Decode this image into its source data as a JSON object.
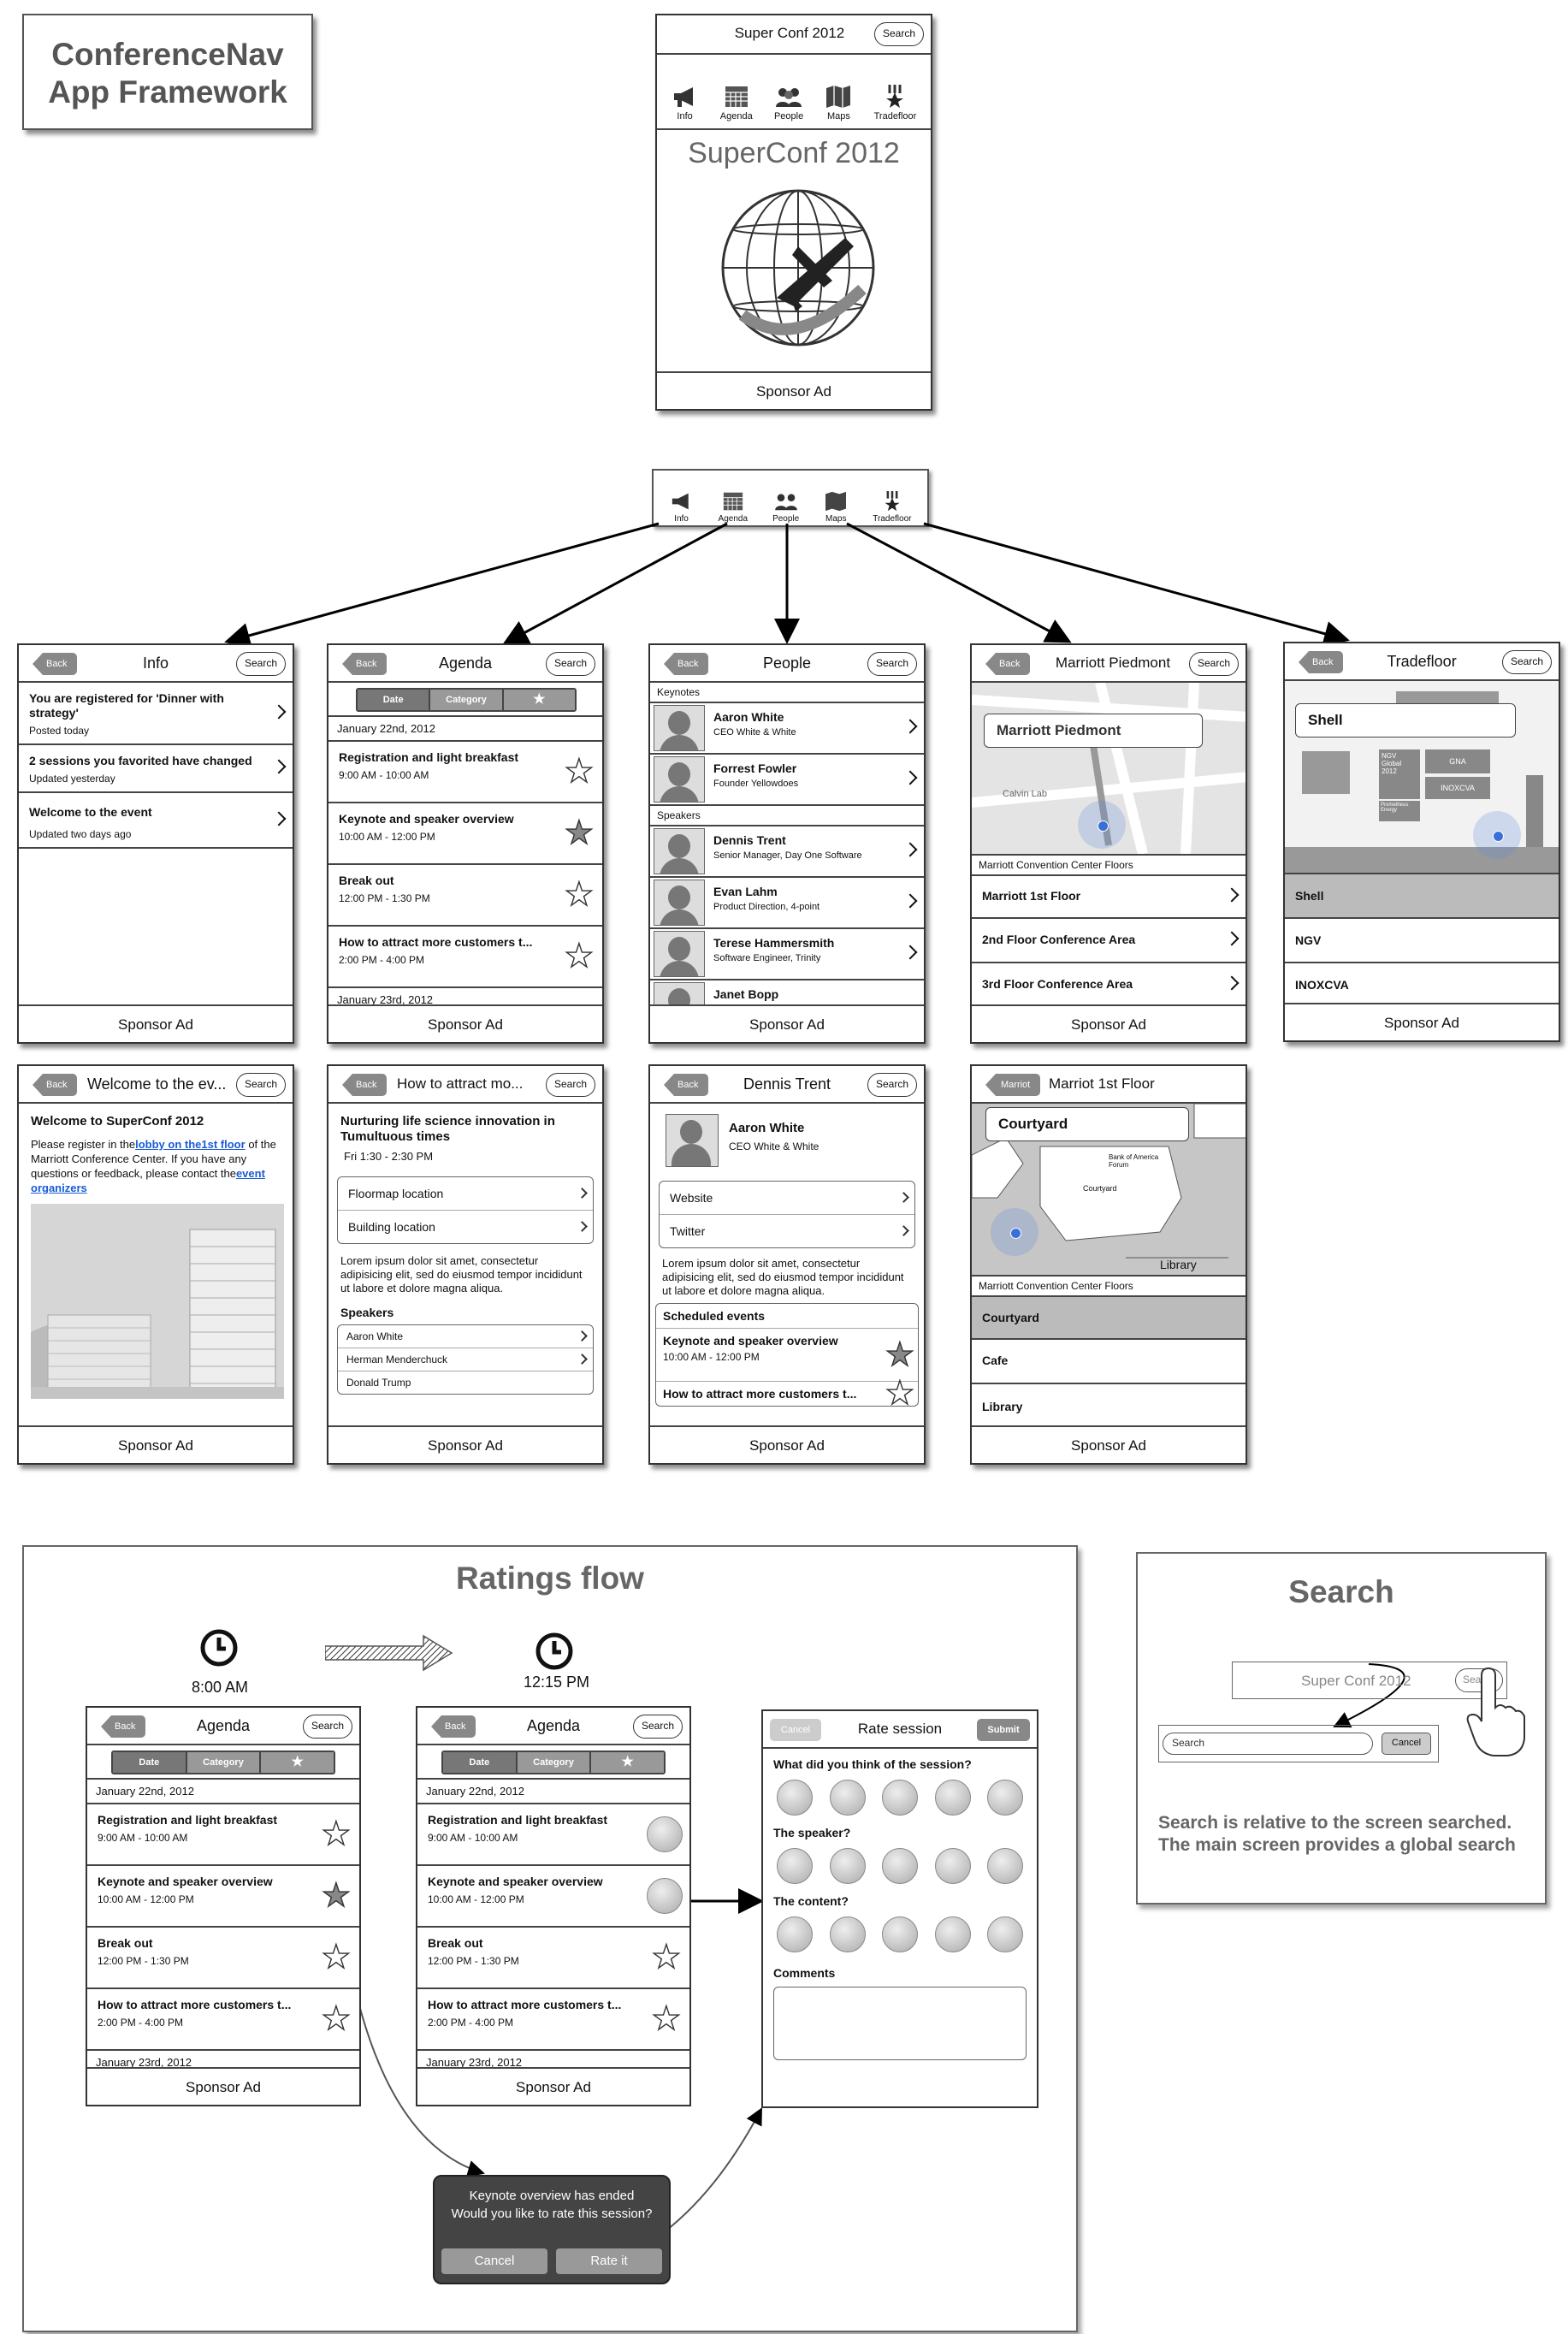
{
  "framework_title": [
    "ConferenceNav",
    "App Framework"
  ],
  "search_label": "Search",
  "sponsor_ad": "Sponsor Ad",
  "back_label": "Back",
  "main_screen": {
    "title": "Super Conf 2012",
    "hero": "SuperConf 2012",
    "tabs": [
      "Info",
      "Agenda",
      "People",
      "Maps",
      "Tradefloor"
    ]
  },
  "info": {
    "title": "Info",
    "items": [
      {
        "t": "You are registered for 'Dinner with strategy'",
        "s": "Posted today"
      },
      {
        "t": "2 sessions you favorited have changed",
        "s": "Updated yesterday"
      },
      {
        "t": "Welcome to the event",
        "s": "Updated two days ago"
      }
    ]
  },
  "agenda": {
    "title": "Agenda",
    "seg": [
      "Date",
      "Category",
      "★"
    ],
    "date1": "January 22nd, 2012",
    "date2": "January 23rd, 2012",
    "items": [
      {
        "t": "Registration and light breakfast",
        "s": "9:00 AM - 10:00 AM"
      },
      {
        "t": "Keynote and speaker overview",
        "s": "10:00 AM - 12:00 PM"
      },
      {
        "t": "Break out",
        "s": "12:00 PM - 1:30 PM"
      },
      {
        "t": "How to attract more customers t...",
        "s": "2:00 PM - 4:00 PM"
      }
    ]
  },
  "people": {
    "title": "People",
    "h1": "Keynotes",
    "h2": "Speakers",
    "keynotes": [
      {
        "n": "Aaron White",
        "r": "CEO White & White"
      },
      {
        "n": "Forrest Fowler",
        "r": "Founder Yellowdoes"
      }
    ],
    "speakers": [
      {
        "n": "Dennis Trent",
        "r": "Senior Manager, Day One Software"
      },
      {
        "n": "Evan Lahm",
        "r": "Product Direction, 4-point"
      },
      {
        "n": "Terese Hammersmith",
        "r": "Software Engineer, Trinity"
      },
      {
        "n": "Janet Bopp",
        "r": ""
      }
    ]
  },
  "maps": {
    "title": "Marriott Piedmont",
    "bubble": "Marriott Piedmont",
    "caption": "Marriott Convention Center Floors",
    "items": [
      "Marriott 1st Floor",
      "2nd Floor Conference Area",
      "3rd Floor Conference Area"
    ],
    "streets": [
      "Calvin Lab"
    ]
  },
  "tradefloor": {
    "title": "Tradefloor",
    "bubble": "Shell",
    "items": [
      "Shell",
      "NGV",
      "INOXCVA"
    ],
    "booths": [
      "NGV Global 2012",
      "GNA",
      "INOXCVA",
      "Prometheus Energy"
    ]
  },
  "welcome": {
    "title": "Welcome to the ev...",
    "heading": "Welcome to SuperConf 2012",
    "t1": "Please register in the",
    "link1": "lobby on the1st floor",
    "t2": "of the Marriott Conference Center. If you have any questions or feedback, please contact the",
    "link2": "event organizers"
  },
  "session": {
    "title": "How to attract mo...",
    "heading": "Nurturing life science innovation in Tumultuous times",
    "time": "Fri 1:30 - 2:30 PM",
    "links": [
      "Floormap location",
      "Building location"
    ],
    "body": "Lorem ipsum dolor sit amet, consectetur adipisicing elit, sed do eiusmod tempor incididunt ut labore et dolore magna aliqua.",
    "speakers_h": "Speakers",
    "speakers": [
      "Aaron White",
      "Herman Menderchuck",
      "Donald Trump"
    ]
  },
  "person": {
    "title": "Dennis Trent",
    "name": "Aaron White",
    "role": "CEO White & White",
    "links": [
      "Website",
      "Twitter"
    ],
    "body": "Lorem ipsum dolor sit amet, consectetur adipisicing elit, sed do eiusmod tempor incididunt ut labore et dolore magna aliqua.",
    "events_h": "Scheduled events",
    "events": [
      {
        "t": "Keynote and speaker overview",
        "s": "10:00 AM - 12:00 PM"
      },
      {
        "t": "How to attract more customers t...",
        "s": ""
      }
    ]
  },
  "floor": {
    "back": "Marriot",
    "title": "Marriot 1st Floor",
    "bubble": "Courtyard",
    "caption": "Marriott Convention Center Floors",
    "items": [
      "Courtyard",
      "Cafe",
      "Library"
    ],
    "labels": [
      "Bank of America Forum",
      "Courtyard",
      "Library"
    ]
  },
  "ratings": {
    "title": "Ratings flow",
    "time1": "8:00 AM",
    "time2": "12:15 PM",
    "rate": {
      "cancel": "Cancel",
      "title": "Rate session",
      "submit": "Submit",
      "q": [
        "What did you think of the session?",
        "The speaker?",
        "The content?"
      ],
      "comments": "Comments"
    },
    "alert": {
      "l1": "Keynote overview has ended",
      "l2": "Would you like to rate this session?",
      "cancel": "Cancel",
      "ok": "Rate it"
    }
  },
  "search": {
    "title": "Search",
    "bar": "Super Conf 2012",
    "btn": "Search",
    "input": "Search",
    "cancel": "Cancel",
    "desc": "Search is relative to the screen searched. The main screen provides a global search"
  }
}
